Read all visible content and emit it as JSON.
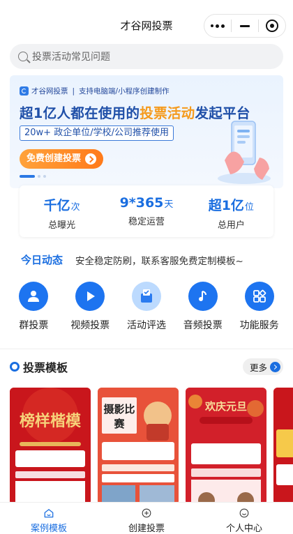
{
  "app": {
    "title": "才谷网投票"
  },
  "search": {
    "placeholder": "投票活动常见问题"
  },
  "banner": {
    "brand": "才谷网投票",
    "brand_tagline": "支持电脑端/小程序创建制作",
    "headline_prefix": "超1亿人都在使用的",
    "headline_highlight": "投票活动",
    "headline_suffix": "发起平台",
    "tagline": "20w+ 政企单位/学校/公司推荐使用",
    "cta": "免费创建投票"
  },
  "stats": [
    {
      "value": "千亿",
      "unit": "次",
      "label": "总曝光"
    },
    {
      "value": "9*365",
      "unit": "天",
      "label": "稳定运营"
    },
    {
      "value": "超1亿",
      "unit": "位",
      "label": "总用户"
    }
  ],
  "today": {
    "title": "今日动态",
    "message": "安全稳定防刷，联系客服免费定制模板~"
  },
  "quick": [
    {
      "label": "群投票",
      "icon": "group-vote-icon"
    },
    {
      "label": "视频投票",
      "icon": "play-icon"
    },
    {
      "label": "活动评选",
      "icon": "activity-icon"
    },
    {
      "label": "音频投票",
      "icon": "music-note-icon"
    },
    {
      "label": "功能服务",
      "icon": "apps-icon"
    }
  ],
  "templates": {
    "title": "投票模板",
    "more": "更多",
    "cards": [
      {
        "title": "榜样楷模",
        "subtitle": ""
      },
      {
        "title": "摄影比赛",
        "subtitle": ""
      },
      {
        "title": "欢庆元旦",
        "subtitle": ""
      },
      {
        "title": "",
        "subtitle": ""
      }
    ]
  },
  "tabbar": [
    {
      "label": "案例模板",
      "icon": "home-icon",
      "active": true
    },
    {
      "label": "创建投票",
      "icon": "plus-circle-icon",
      "active": false
    },
    {
      "label": "个人中心",
      "icon": "user-icon",
      "active": false
    }
  ],
  "colors": {
    "accent": "#1a6ee0",
    "orange": "#f59a1c",
    "card_red": "#d32323"
  }
}
